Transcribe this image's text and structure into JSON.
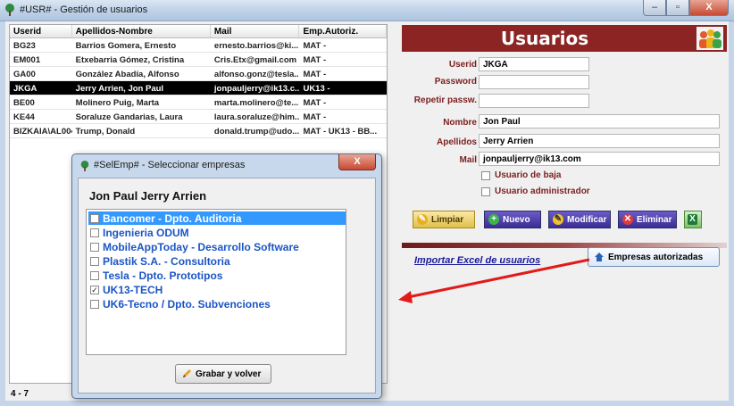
{
  "window": {
    "title": "#USR# - Gestión de usuarios",
    "min": "–",
    "max": "▫",
    "close": "X"
  },
  "list": {
    "headers": [
      "Userid",
      "Apellidos-Nombre",
      "Mail",
      "Emp.Autoriz."
    ],
    "rows": [
      [
        "BG23",
        "Barrios Gomera, Ernesto",
        "ernesto.barrios@ki...",
        "MAT -"
      ],
      [
        "EM001",
        "Etxebarria Gómez, Cristina",
        "Cris.Etx@gmail.com",
        "MAT -"
      ],
      [
        "GA00",
        "González Abadía, Alfonso",
        "alfonso.gonz@tesla...",
        "MAT -"
      ],
      [
        "JKGA",
        "Jerry Arrien, Jon Paul",
        "jonpauljerry@ik13.c...",
        "UK13 -"
      ],
      [
        "BE00",
        "Molinero Puig, Marta",
        "marta.molinero@te...",
        "MAT -"
      ],
      [
        "KE44",
        "Soraluze Gandarias, Laura",
        "laura.soraluze@him...",
        "MAT -"
      ],
      [
        "BIZKAIA\\AL004",
        "Trump, Donald",
        "donald.trump@udo...",
        "MAT - UK13 - BB..."
      ]
    ],
    "footer": "4 - 7"
  },
  "panel": {
    "title": "Usuarios",
    "labels": {
      "userid": "Userid",
      "password": "Password",
      "repeat": "Repetir passw.",
      "nombre": "Nombre",
      "apellidos": "Apellidos",
      "mail": "Mail"
    },
    "values": {
      "userid": "JKGA",
      "password": "",
      "repeat": "",
      "nombre": "Jon Paul",
      "apellidos": "Jerry Arrien",
      "mail": "jonpauljerry@ik13.com"
    },
    "checks": {
      "baja": "Usuario de baja",
      "admin": "Usuario administrador"
    },
    "buttons": {
      "limpiar": "Limpiar",
      "nuevo": "Nuevo",
      "modificar": "Modificar",
      "eliminar": "Eliminar"
    },
    "import_link": "Importar Excel de usuarios",
    "empresas_btn": "Empresas autorizadas"
  },
  "dialog": {
    "title": "#SelEmp# - Seleccionar empresas",
    "close": "X",
    "user_name": "Jon Paul Jerry Arrien",
    "items": [
      {
        "label": "Bancomer - Dpto. Auditoria",
        "checked": false
      },
      {
        "label": "Ingenieria ODUM",
        "checked": false
      },
      {
        "label": "MobileAppToday - Desarrollo Software",
        "checked": false
      },
      {
        "label": "Plastik S.A. - Consultoria",
        "checked": false
      },
      {
        "label": "Tesla - Dpto. Prototipos",
        "checked": false
      },
      {
        "label": "UK13-TECH",
        "checked": true
      },
      {
        "label": "UK6-Tecno  / Dpto. Subvenciones",
        "checked": false
      }
    ],
    "save_btn": "Grabar y volver"
  },
  "colors": {
    "accent": "#8d2424",
    "link": "#1a1a9c",
    "selection": "#3399ff",
    "arrow": "#e21a1a"
  }
}
